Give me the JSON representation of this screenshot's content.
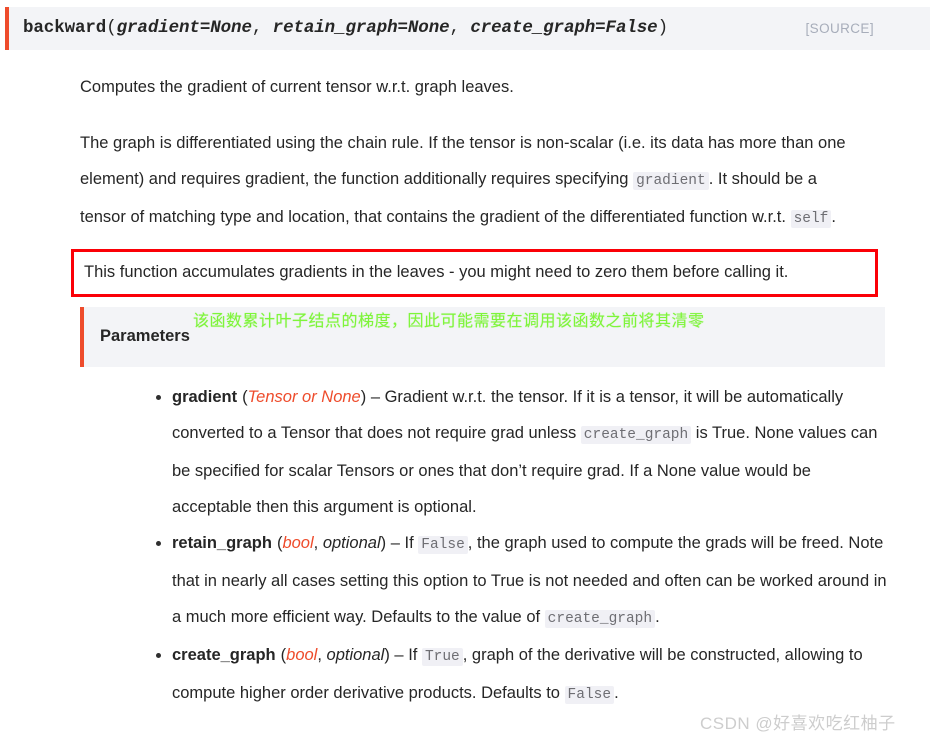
{
  "signature": {
    "name": "backward",
    "open_paren": "(",
    "params": [
      {
        "text": "gradient=None",
        "sep": ", "
      },
      {
        "text": "retain_graph=None",
        "sep": ", "
      },
      {
        "text": "create_graph=False",
        "sep": ""
      }
    ],
    "close_paren": ")",
    "source_label": "[SOURCE]"
  },
  "body": {
    "para1": "Computes the gradient of current tensor w.r.t. graph leaves.",
    "para2_a": "The graph is differentiated using the chain rule. If the tensor is non-scalar (i.e. its data has more than one element) and requires gradient, the function additionally requires specifying ",
    "para2_code1": "gradient",
    "para2_b": ". It should be a tensor of matching type and location, that contains the gradient of the differentiated function w.r.t. ",
    "para2_code2": "self",
    "para2_c": "."
  },
  "highlight": {
    "text": "This function accumulates gradients in the leaves - you might need to zero them before calling it.",
    "border_color": "#fb0007"
  },
  "annotation": {
    "chinese_note": "该函数累计叶子结点的梯度，因此可能需要在调用该函数之前将其清零",
    "color": "#7ef53a"
  },
  "parameters": {
    "title": "Parameters",
    "accent_color": "#ee4c2c",
    "items": [
      {
        "name": "gradient",
        "type_open": "(",
        "type_primary": "Tensor",
        "type_join": " or ",
        "type_secondary": "None",
        "type_close": ")",
        "dash": " – ",
        "desc_a": "Gradient w.r.t. the tensor. If it is a tensor, it will be automatically converted to a Tensor that does not require grad unless ",
        "code1": "create_graph",
        "desc_b": " is True. None values can be specified for scalar Tensors or ones that don’t require grad. If a None value would be acceptable then this argument is optional."
      },
      {
        "name": "retain_graph",
        "type_open": "(",
        "type_primary": "bool",
        "type_join": ", ",
        "type_secondary": "optional",
        "type_close": ")",
        "dash": " – ",
        "desc_a": "If ",
        "code1": "False",
        "desc_b": ", the graph used to compute the grads will be freed. Note that in nearly all cases setting this option to True is not needed and often can be worked around in a much more efficient way. Defaults to the value of ",
        "code2": "create_graph",
        "desc_c": "."
      },
      {
        "name": "create_graph",
        "type_open": "(",
        "type_primary": "bool",
        "type_join": ", ",
        "type_secondary": "optional",
        "type_close": ")",
        "dash": " – ",
        "desc_a": "If ",
        "code1": "True",
        "desc_b": ", graph of the derivative will be constructed, allowing to compute higher order derivative products. Defaults to ",
        "code2": "False",
        "desc_c": "."
      }
    ]
  },
  "watermark": {
    "text": "CSDN @好喜欢吃红柚子"
  }
}
